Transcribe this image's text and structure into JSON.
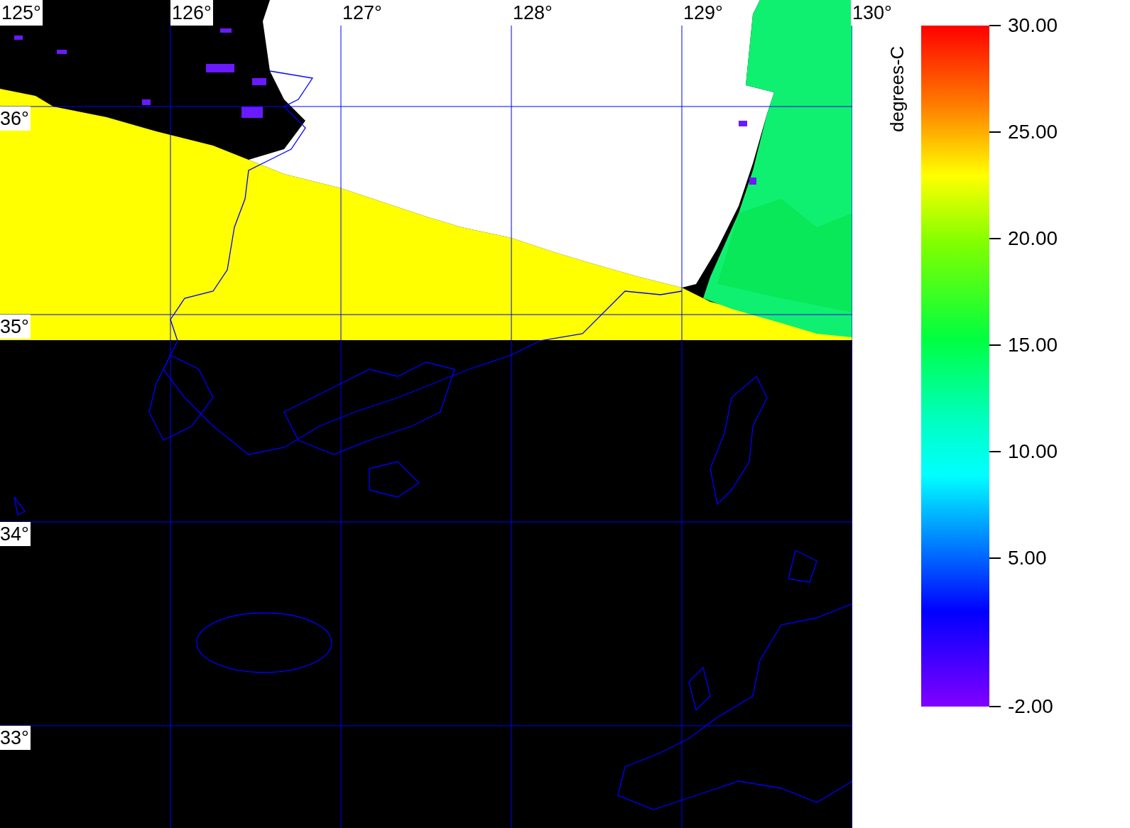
{
  "map": {
    "lon_labels": [
      "125°",
      "126°",
      "127°",
      "128°",
      "129°",
      "130°"
    ],
    "lat_labels": [
      "36°",
      "35°",
      "34°",
      "33°"
    ]
  },
  "colorbar": {
    "unit": "degrees-C",
    "ticks": [
      "30.00",
      "25.00",
      "20.00",
      "15.00",
      "10.00",
      "5.00",
      "-2.00"
    ]
  }
}
